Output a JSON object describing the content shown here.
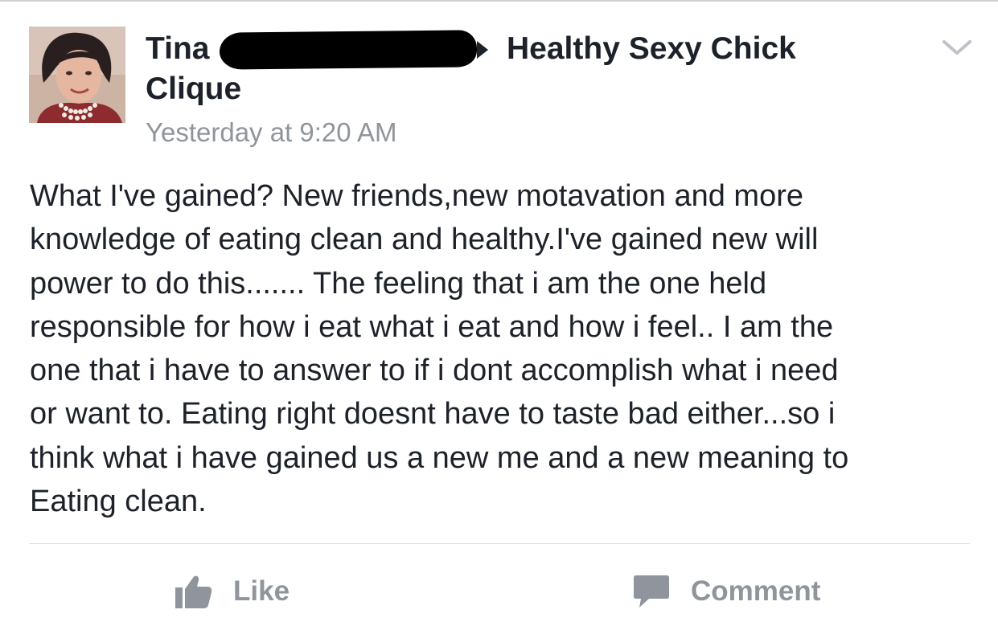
{
  "post": {
    "author_visible": "Tina",
    "group_name_line1": "Healthy Sexy Chick",
    "group_name_line2": "Clique",
    "timestamp": "Yesterday at 9:20 AM",
    "body": "What I've gained?  New friends,new motavation and more\nknowledge of eating clean and healthy.I've gained new will\npower to do this....... The feeling that i am the one held\nresponsible for how i eat what i eat and how i feel.. I am the\none that i have to answer to if i dont accomplish what i need\nor want to. Eating right doesnt have to taste bad either...so i\nthink what i have gained us a new me and a new meaning to\nEating clean."
  },
  "actions": {
    "like_label": "Like",
    "comment_label": "Comment"
  },
  "icons": {
    "menu": "chevron-down-icon",
    "like": "thumbs-up-icon",
    "comment": "comment-bubble-icon",
    "share_arrow": "triangle-right-icon"
  },
  "colors": {
    "text": "#1d2129",
    "muted": "#90949c",
    "divider": "#dddfe2"
  }
}
